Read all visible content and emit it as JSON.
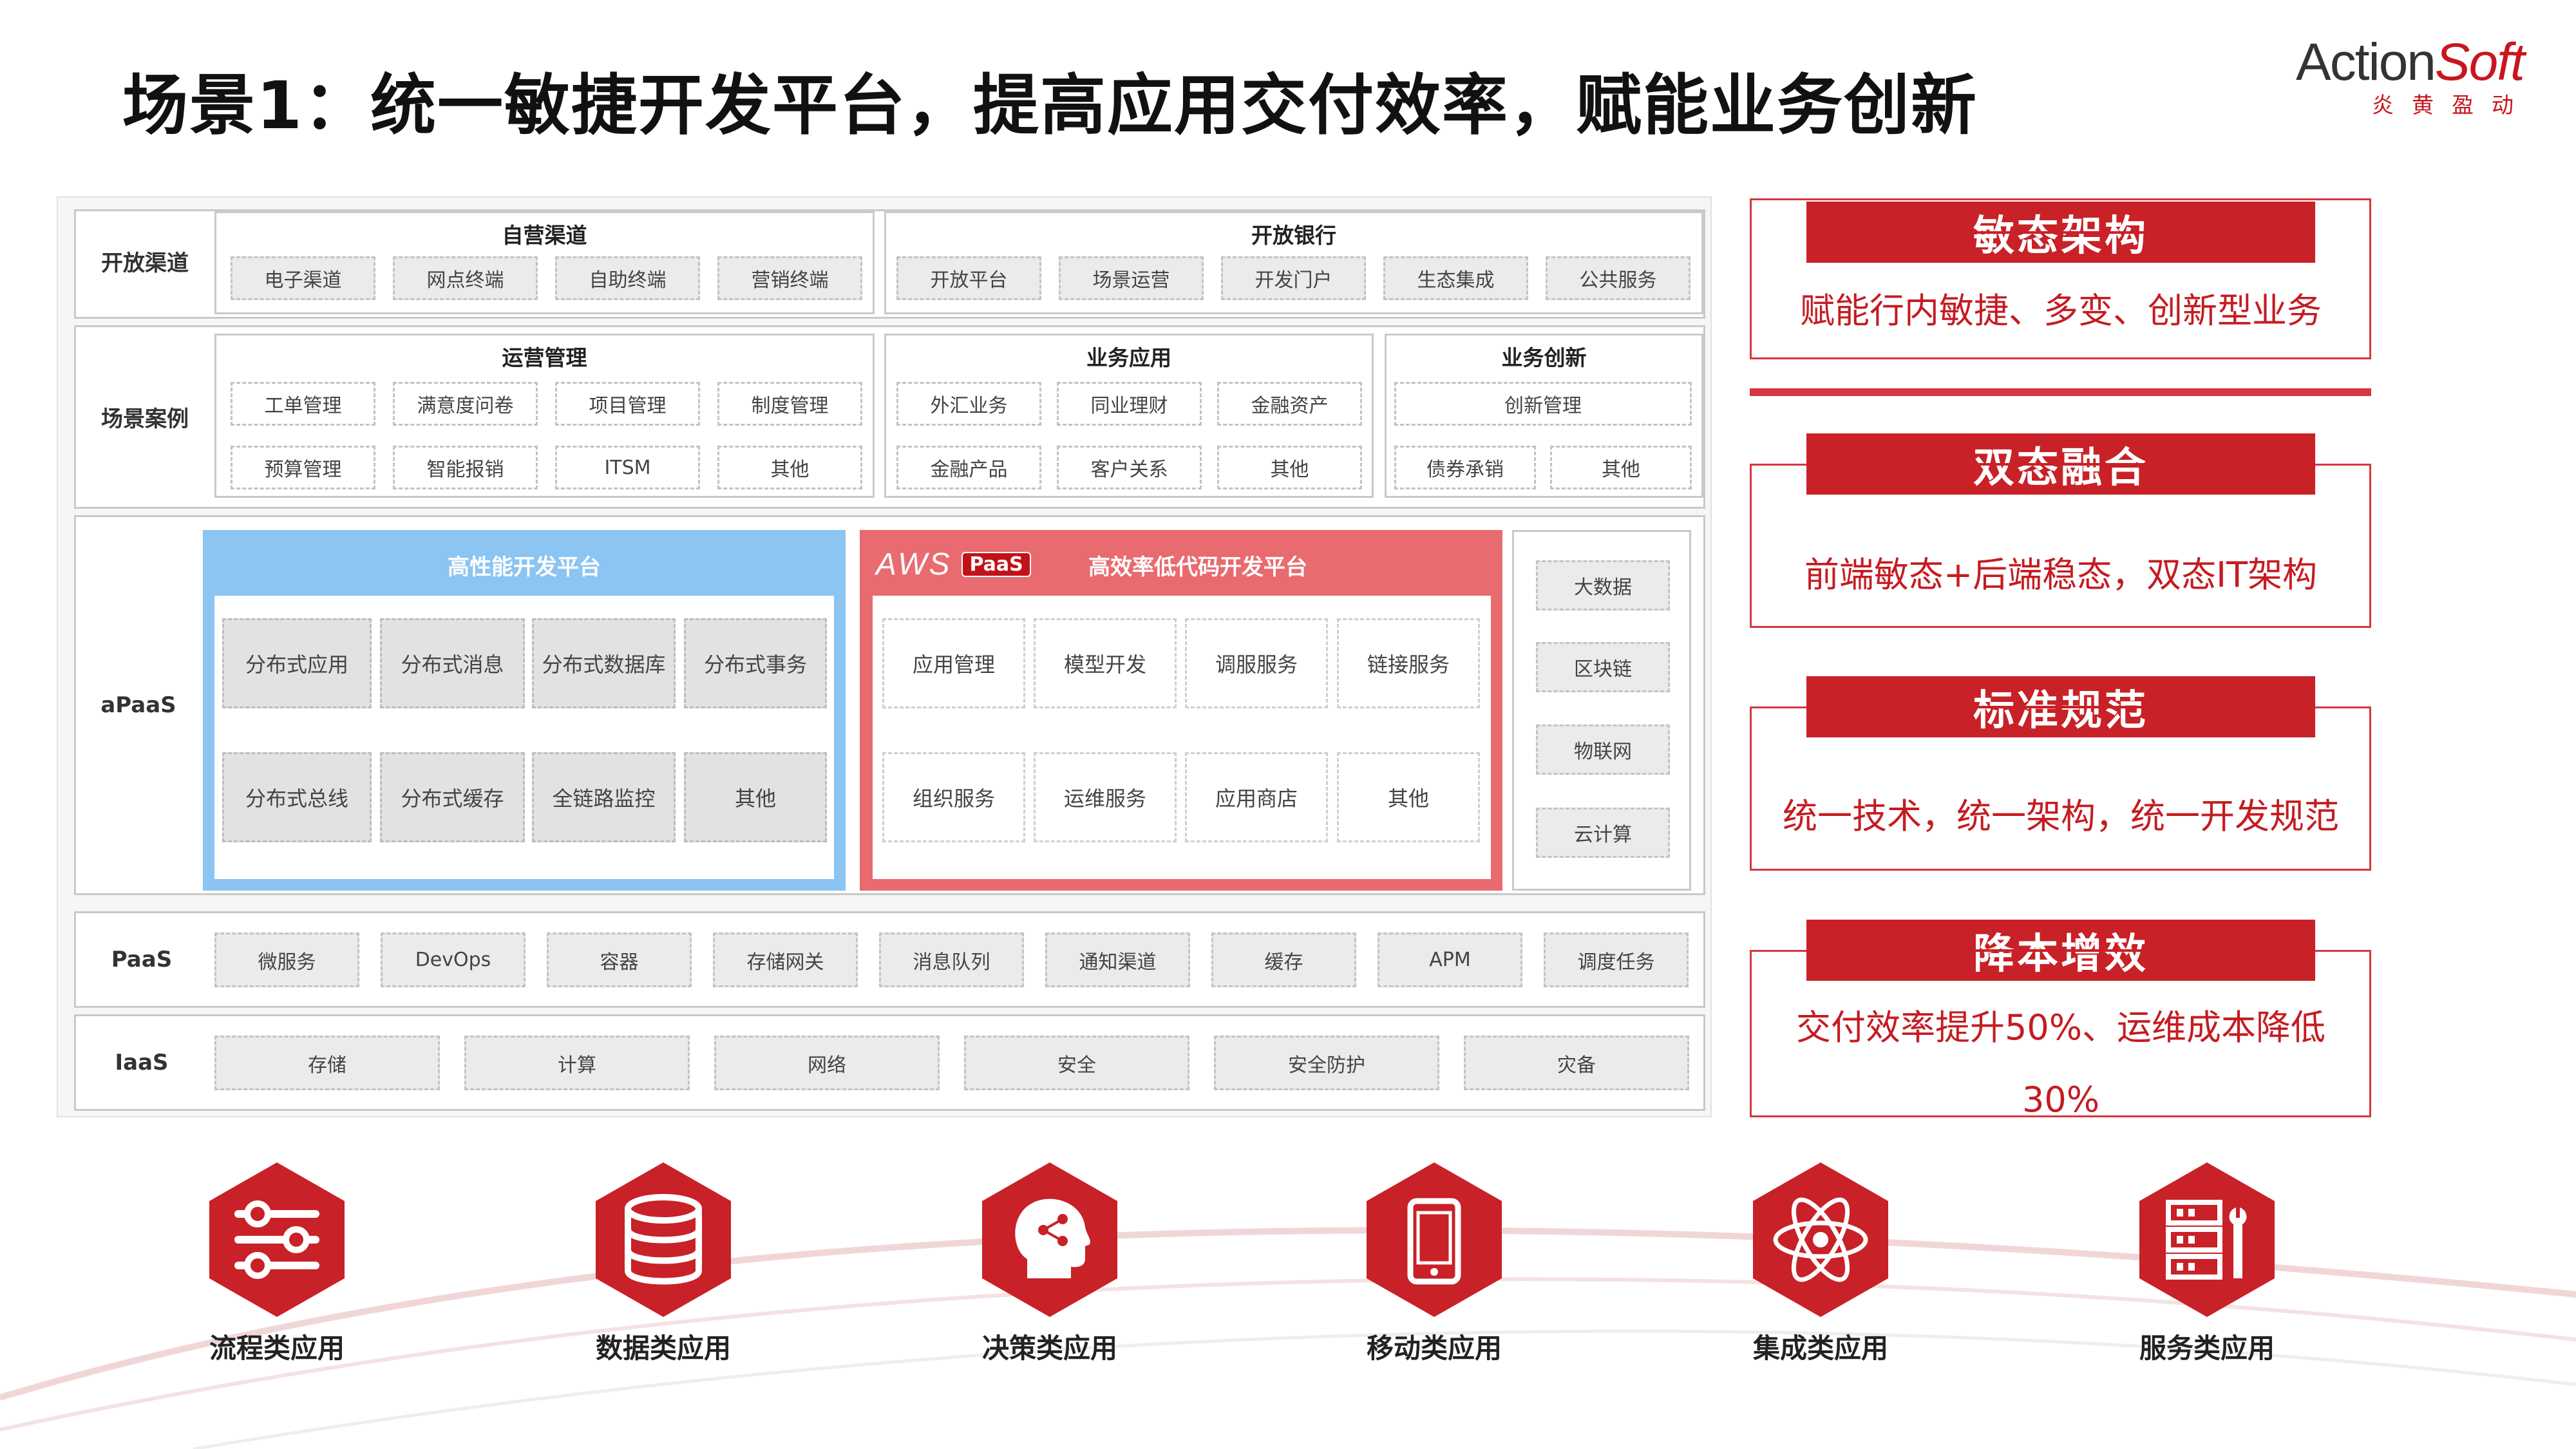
{
  "title": "场景1：统一敏捷开发平台，提高应用交付效率，赋能业务创新",
  "logo": {
    "brand_action": "Action",
    "brand_soft": "Soft",
    "sub": "炎黄盈动"
  },
  "rows": {
    "open_channel": {
      "label": "开放渠道",
      "groups": [
        {
          "title": "自营渠道",
          "items": [
            "电子渠道",
            "网点终端",
            "自助终端",
            "营销终端"
          ]
        },
        {
          "title": "开放银行",
          "items": [
            "开放平台",
            "场景运营",
            "开发门户",
            "生态集成",
            "公共服务"
          ]
        }
      ]
    },
    "scenario": {
      "label": "场景案例",
      "groups": [
        {
          "title": "运营管理",
          "items": [
            "工单管理",
            "满意度问卷",
            "项目管理",
            "制度管理",
            "预算管理",
            "智能报销",
            "ITSM",
            "其他"
          ]
        },
        {
          "title": "业务应用",
          "items": [
            "外汇业务",
            "同业理财",
            "金融资产",
            "金融产品",
            "客户关系",
            "其他"
          ]
        },
        {
          "title": "业务创新",
          "items": [
            "创新管理",
            "债券承销",
            "其他"
          ]
        }
      ]
    },
    "apaas": {
      "label": "aPaaS",
      "high_perf": {
        "title": "高性能开发平台",
        "items": [
          "分布式应用",
          "分布式消息",
          "分布式数据库",
          "分布式事务",
          "分布式总线",
          "分布式缓存",
          "全链路监控",
          "其他"
        ]
      },
      "low_code": {
        "aws": "AWS",
        "paas_badge": "PaaS",
        "title": "高效率低代码开发平台",
        "items": [
          "应用管理",
          "模型开发",
          "调服服务",
          "链接服务",
          "组织服务",
          "运维服务",
          "应用商店",
          "其他"
        ]
      },
      "side": [
        "大数据",
        "区块链",
        "物联网",
        "云计算"
      ]
    },
    "paas": {
      "label": "PaaS",
      "items": [
        "微服务",
        "DevOps",
        "容器",
        "存储网关",
        "消息队列",
        "通知渠道",
        "缓存",
        "APM",
        "调度任务"
      ]
    },
    "iaas": {
      "label": "IaaS",
      "items": [
        "存储",
        "计算",
        "网络",
        "安全",
        "安全防护",
        "灾备"
      ]
    }
  },
  "values": [
    {
      "title": "敏态架构",
      "text": "赋能行内敏捷、多变、创新型业务"
    },
    {
      "title": "双态融合",
      "text": "前端敏态+后端稳态，双态IT架构"
    },
    {
      "title": "标准规范",
      "text": "统一技术，统一架构，统一开发规范"
    },
    {
      "title": "降本增效",
      "text": "交付效率提升50%、运维成本降低30%"
    }
  ],
  "apps": [
    {
      "label": "流程类应用",
      "icon": "sliders-icon"
    },
    {
      "label": "数据类应用",
      "icon": "database-icon"
    },
    {
      "label": "决策类应用",
      "icon": "head-network-icon"
    },
    {
      "label": "移动类应用",
      "icon": "mobile-icon"
    },
    {
      "label": "集成类应用",
      "icon": "atom-icon"
    },
    {
      "label": "服务类应用",
      "icon": "server-tools-icon"
    }
  ],
  "colors": {
    "accent_red": "#c82127",
    "blue_panel": "#8cc4f2",
    "red_panel": "#e86b70"
  }
}
